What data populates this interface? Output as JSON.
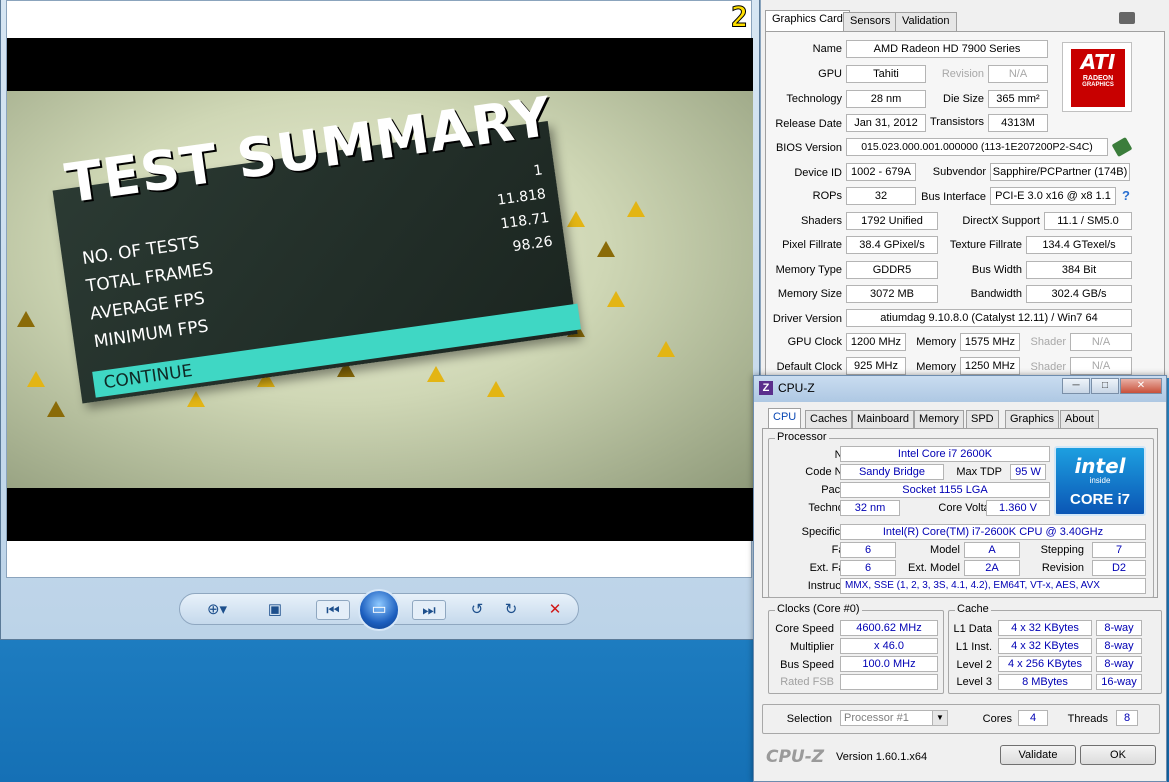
{
  "viewer": {
    "frame_counter": "2",
    "summary_title": "TEST SUMMARY",
    "rows": [
      {
        "label": "NO. OF TESTS",
        "value": "1"
      },
      {
        "label": "TOTAL FRAMES",
        "value": "11.818"
      },
      {
        "label": "AVERAGE FPS",
        "value": "118.71"
      },
      {
        "label": "MINIMUM FPS",
        "value": "98.26"
      }
    ],
    "continue_label": "CONTINUE",
    "toolbar": {
      "zoom_icon": "zoom-icon",
      "fit_icon": "fit-window-icon",
      "prev_icon": "previous-icon",
      "slideshow_icon": "slideshow-icon",
      "next_icon": "next-icon",
      "rotate_ccw_icon": "rotate-left-icon",
      "rotate_cw_icon": "rotate-right-icon",
      "delete_icon": "delete-icon"
    }
  },
  "gpuz": {
    "tabs": [
      "Graphics Card",
      "Sensors",
      "Validation"
    ],
    "logo_text": "ATI",
    "logo_sub": "RADEON",
    "logo_sub2": "GRAPHICS",
    "name_label": "Name",
    "name": "AMD Radeon HD 7900 Series",
    "gpu_label": "GPU",
    "gpu": "Tahiti",
    "revision_label": "Revision",
    "revision": "N/A",
    "technology_label": "Technology",
    "technology": "28 nm",
    "die_size_label": "Die Size",
    "die_size": "365 mm²",
    "release_date_label": "Release Date",
    "release_date": "Jan 31, 2012",
    "transistors_label": "Transistors",
    "transistors": "4313M",
    "bios_label": "BIOS Version",
    "bios": "015.023.000.001.000000 (113-1E207200P2-S4C)",
    "device_id_label": "Device ID",
    "device_id": "1002 - 679A",
    "subvendor_label": "Subvendor",
    "subvendor": "Sapphire/PCPartner (174B)",
    "rops_label": "ROPs",
    "rops": "32",
    "bus_interface_label": "Bus Interface",
    "bus_interface": "PCI-E 3.0 x16 @ x8 1.1",
    "shaders_label": "Shaders",
    "shaders": "1792 Unified",
    "directx_label": "DirectX Support",
    "directx": "11.1 / SM5.0",
    "pixel_fillrate_label": "Pixel Fillrate",
    "pixel_fillrate": "38.4 GPixel/s",
    "texture_fillrate_label": "Texture Fillrate",
    "texture_fillrate": "134.4 GTexel/s",
    "memory_type_label": "Memory Type",
    "memory_type": "GDDR5",
    "bus_width_label": "Bus Width",
    "bus_width": "384 Bit",
    "memory_size_label": "Memory Size",
    "memory_size": "3072 MB",
    "bandwidth_label": "Bandwidth",
    "bandwidth": "302.4 GB/s",
    "driver_label": "Driver Version",
    "driver": "atiumdag 9.10.8.0 (Catalyst 12.11) / Win7 64",
    "gpu_clock_label": "GPU Clock",
    "gpu_clock": "1200 MHz",
    "memory_label": "Memory",
    "memory_clock": "1575 MHz",
    "shader_label": "Shader",
    "shader_clock": "N/A",
    "default_clock_label": "Default Clock",
    "default_clock": "925 MHz",
    "default_memory": "1250 MHz",
    "default_shader": "N/A"
  },
  "cpuz": {
    "title": "CPU-Z",
    "tabs": [
      "CPU",
      "Caches",
      "Mainboard",
      "Memory",
      "SPD",
      "Graphics",
      "About"
    ],
    "processor_group": "Processor",
    "name_label": "Name",
    "name": "Intel Core i7 2600K",
    "code_name_label": "Code Name",
    "code_name": "Sandy Bridge",
    "max_tdp_label": "Max TDP",
    "max_tdp": "95 W",
    "package_label": "Package",
    "package": "Socket 1155 LGA",
    "technology_label": "Technology",
    "technology": "32 nm",
    "core_voltage_label": "Core Voltage",
    "core_voltage": "1.360 V",
    "specification_label": "Specification",
    "specification": "Intel(R) Core(TM) i7-2600K CPU @ 3.40GHz",
    "family_label": "Family",
    "family": "6",
    "model_label": "Model",
    "model": "A",
    "stepping_label": "Stepping",
    "stepping": "7",
    "ext_family_label": "Ext. Family",
    "ext_family": "6",
    "ext_model_label": "Ext. Model",
    "ext_model": "2A",
    "revision_label": "Revision",
    "revision": "D2",
    "instructions_label": "Instructions",
    "instructions": "MMX, SSE (1, 2, 3, 3S, 4.1, 4.2), EM64T, VT-x, AES, AVX",
    "intel_word": "intel",
    "intel_inside": "inside",
    "intel_core": "CORE i7",
    "clocks_group": "Clocks (Core #0)",
    "core_speed_label": "Core Speed",
    "core_speed": "4600.62 MHz",
    "multiplier_label": "Multiplier",
    "multiplier": "x 46.0",
    "bus_speed_label": "Bus Speed",
    "bus_speed": "100.0 MHz",
    "rated_fsb_label": "Rated FSB",
    "rated_fsb": "",
    "cache_group": "Cache",
    "l1_data_label": "L1 Data",
    "l1_data": "4 x 32 KBytes",
    "l1_data_way": "8-way",
    "l1_inst_label": "L1 Inst.",
    "l1_inst": "4 x 32 KBytes",
    "l1_inst_way": "8-way",
    "level2_label": "Level 2",
    "level2": "4 x 256 KBytes",
    "level2_way": "8-way",
    "level3_label": "Level 3",
    "level3": "8 MBytes",
    "level3_way": "16-way",
    "selection_label": "Selection",
    "selection": "Processor #1",
    "cores_label": "Cores",
    "cores": "4",
    "threads_label": "Threads",
    "threads": "8",
    "brand": "CPU-Z",
    "version": "Version 1.60.1.x64",
    "validate_label": "Validate",
    "ok_label": "OK"
  }
}
